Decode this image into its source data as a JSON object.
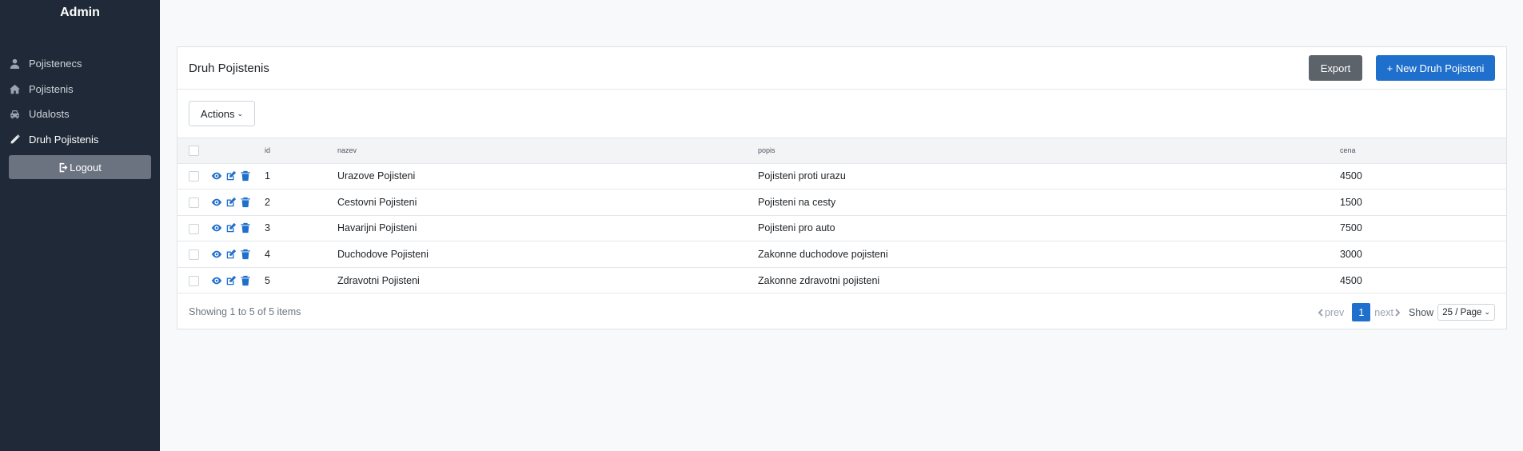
{
  "sidebar": {
    "brand": "Admin",
    "items": [
      {
        "label": "Pojistenecs",
        "icon": "user-icon"
      },
      {
        "label": "Pojistenis",
        "icon": "home-icon"
      },
      {
        "label": "Udalosts",
        "icon": "car-icon"
      },
      {
        "label": "Druh Pojistenis",
        "icon": "pencil-icon"
      }
    ],
    "logout_label": "Logout"
  },
  "card": {
    "title": "Druh Pojistenis",
    "export_label": "Export",
    "new_label": "+ New Druh Pojisteni",
    "actions_label": "Actions"
  },
  "table": {
    "columns": [
      "id",
      "nazev",
      "popis",
      "cena"
    ],
    "rows": [
      {
        "id": "1",
        "nazev": "Urazove Pojisteni",
        "popis": "Pojisteni proti urazu",
        "cena": "4500"
      },
      {
        "id": "2",
        "nazev": "Cestovni Pojisteni",
        "popis": "Pojisteni na cesty",
        "cena": "1500"
      },
      {
        "id": "3",
        "nazev": "Havarijni Pojisteni",
        "popis": "Pojisteni pro auto",
        "cena": "7500"
      },
      {
        "id": "4",
        "nazev": "Duchodove Pojisteni",
        "popis": "Zakonne duchodove pojisteni",
        "cena": "3000"
      },
      {
        "id": "5",
        "nazev": "Zdravotni Pojisteni",
        "popis": "Zakonne zdravotni pojisteni",
        "cena": "4500"
      }
    ]
  },
  "footer": {
    "showing": "Showing 1 to 5 of 5 items",
    "prev_label": "prev",
    "next_label": "next",
    "current_page": "1",
    "show_label": "Show",
    "per_page": "25 / Page"
  },
  "colors": {
    "sidebar_bg": "#1f2937",
    "primary": "#1f6fcc",
    "secondary": "#5c636a"
  }
}
